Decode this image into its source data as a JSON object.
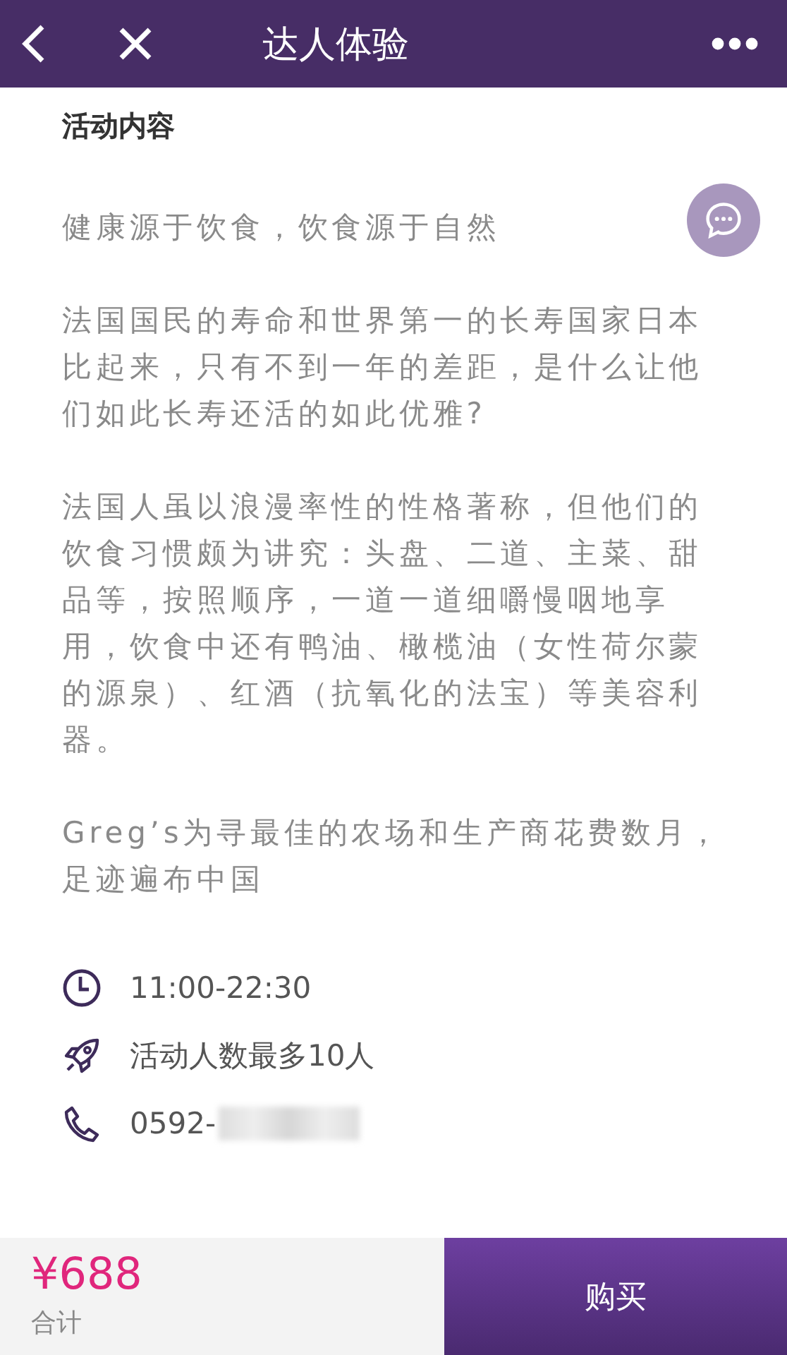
{
  "header": {
    "title": "达人体验"
  },
  "section": {
    "title": "活动内容",
    "paragraphs": [
      "健康源于饮食，饮食源于自然",
      "法国国民的寿命和世界第一的长寿国家日本比起来，只有不到一年的差距，是什么让他们如此长寿还活的如此优雅?",
      "法国人虽以浪漫率性的性格著称，但他们的饮食习惯颇为讲究：头盘、二道、主菜、甜品等，按照顺序，一道一道细嚼慢咽地享用，饮食中还有鸭油、橄榄油（女性荷尔蒙的源泉）、红酒（抗氧化的法宝）等美容利器。",
      "Greg’s为寻最佳的农场和生产商花费数月，足迹遍布中国"
    ]
  },
  "info": [
    {
      "kind": "time",
      "text": "11:00-22:30"
    },
    {
      "kind": "people",
      "text": "活动人数最多10人"
    },
    {
      "kind": "phone",
      "text": "0592-",
      "redacted": true
    }
  ],
  "footer": {
    "price": "¥688",
    "price_label": "合计",
    "buy_button": "购买"
  }
}
